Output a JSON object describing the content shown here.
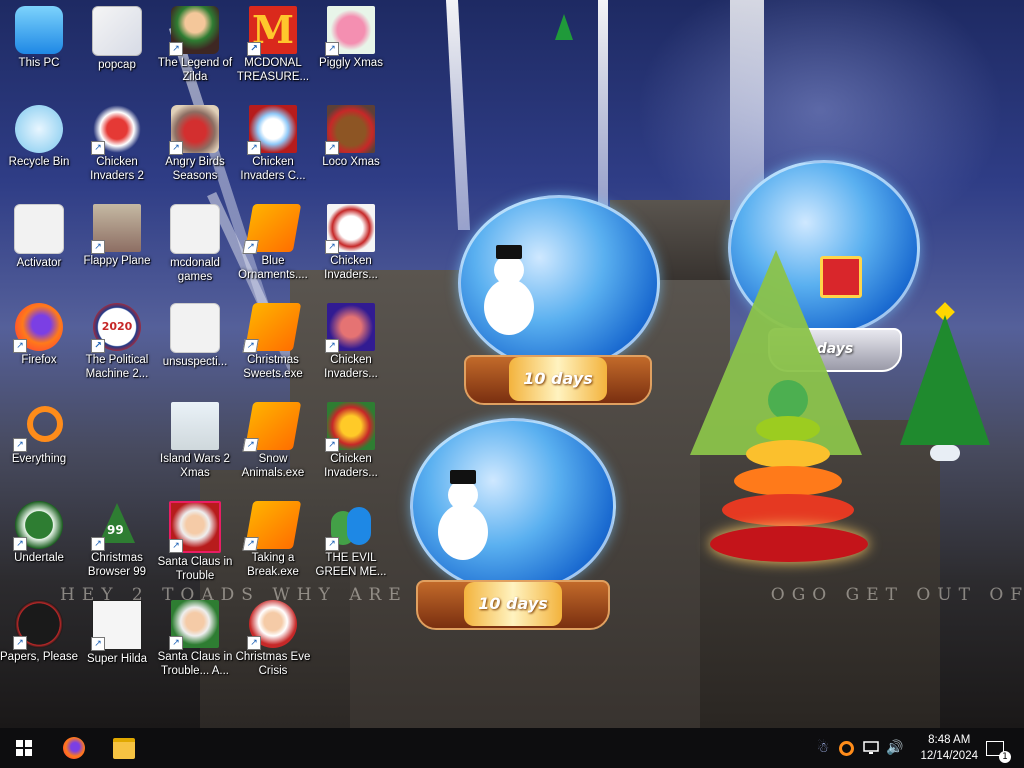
{
  "desktop": {
    "banner_text": "HEY 2 TOADS WHY ARE YOU DOING",
    "banner_text_right": "OGO GET OUT OF HERE NOW!!!",
    "icons": [
      {
        "label": "This PC"
      },
      {
        "label": "popcap"
      },
      {
        "label": "The Legend of Zilda"
      },
      {
        "label": "MCDONAL TREASURE..."
      },
      {
        "label": "Piggly Xmas"
      },
      {
        "label": "Recycle Bin"
      },
      {
        "label": "Chicken Invaders 2"
      },
      {
        "label": "Angry Birds Seasons"
      },
      {
        "label": "Chicken Invaders C..."
      },
      {
        "label": "Loco Xmas"
      },
      {
        "label": "Activator"
      },
      {
        "label": "Flappy Plane"
      },
      {
        "label": "mcdonald games"
      },
      {
        "label": "Blue Ornaments...."
      },
      {
        "label": "Chicken Invaders..."
      },
      {
        "label": "Firefox"
      },
      {
        "label": "The Political Machine 2..."
      },
      {
        "label": "unsuspecti..."
      },
      {
        "label": "Christmas Sweets.exe"
      },
      {
        "label": "Chicken Invaders..."
      },
      {
        "label": "Everything"
      },
      {
        "label": "Island Wars 2 Xmas"
      },
      {
        "label": "Snow Animals.exe"
      },
      {
        "label": "Chicken Invaders..."
      },
      {
        "label": "Undertale"
      },
      {
        "label": "Christmas Browser 99"
      },
      {
        "label": "Santa Claus in Trouble"
      },
      {
        "label": "Taking a Break.exe"
      },
      {
        "label": "THE EVIL GREEN ME..."
      },
      {
        "label": "Papers, Please"
      },
      {
        "label": "Super Hilda"
      },
      {
        "label": "Santa Claus in Trouble... A..."
      },
      {
        "label": "Christmas Eve Crisis"
      }
    ],
    "widgets": {
      "globe1_text": "10 days",
      "globe2_text": "10 days",
      "globe3_text": "days",
      "politcal_badge": "2020",
      "browser_badge": "99"
    }
  },
  "taskbar": {
    "start_icon": "windows-logo-icon",
    "pinned": [
      "firefox-icon",
      "file-explorer-icon"
    ],
    "tray_icons": [
      "network-people-icon",
      "search-tool-icon",
      "network-icon",
      "volume-icon"
    ],
    "time": "8:48 AM",
    "date": "12/14/2024",
    "notification_count": "1"
  },
  "colors": {
    "taskbar_bg": "#0d0d0f",
    "sky_top": "#1e2a63",
    "globe_blue": "#5ab0f0"
  }
}
